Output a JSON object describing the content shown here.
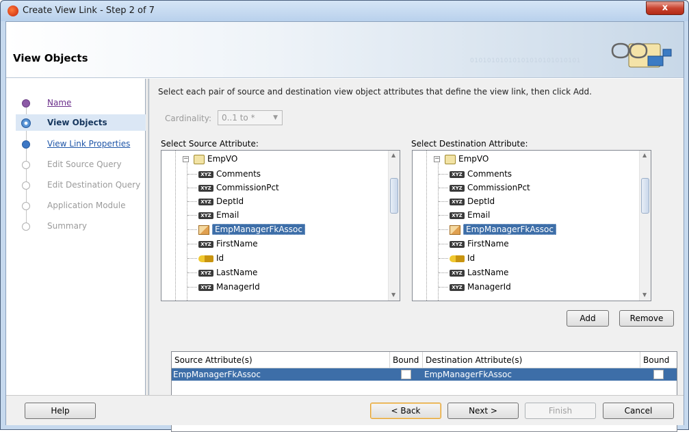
{
  "window": {
    "title": "Create View Link - Step 2 of 7",
    "close_glyph": "x"
  },
  "header": {
    "title": "View Objects",
    "binary_text": "01010101010101010101010101"
  },
  "nav": {
    "items": [
      {
        "label": "Name",
        "state": "done"
      },
      {
        "label": "View Objects",
        "state": "current"
      },
      {
        "label": "View Link Properties",
        "state": "next"
      },
      {
        "label": "Edit Source Query",
        "state": "disabled"
      },
      {
        "label": "Edit Destination Query",
        "state": "disabled"
      },
      {
        "label": "Application Module",
        "state": "disabled"
      },
      {
        "label": "Summary",
        "state": "disabled"
      }
    ]
  },
  "main": {
    "instructions": "Select each pair of source and destination view object attributes that define the view link, then click Add.",
    "cardinality_label": "Cardinality:",
    "cardinality_value": "0..1 to *",
    "source_label": "Select Source Attribute:",
    "destination_label": "Select Destination Attribute:"
  },
  "tree": {
    "root": "EmpVO",
    "attributes": [
      {
        "name": "Comments",
        "icon": "xyz-attribute-icon"
      },
      {
        "name": "CommissionPct",
        "icon": "xyz-attribute-icon"
      },
      {
        "name": "DeptId",
        "icon": "xyz-attribute-icon"
      },
      {
        "name": "Email",
        "icon": "xyz-attribute-icon"
      },
      {
        "name": "EmpManagerFkAssoc",
        "icon": "association-icon",
        "selected": true
      },
      {
        "name": "FirstName",
        "icon": "xyz-attribute-icon"
      },
      {
        "name": "Id",
        "icon": "key-icon"
      },
      {
        "name": "LastName",
        "icon": "xyz-attribute-icon"
      },
      {
        "name": "ManagerId",
        "icon": "xyz-attribute-icon"
      }
    ]
  },
  "buttons": {
    "add": "Add",
    "remove": "Remove",
    "help": "Help",
    "back": "< Back",
    "next": "Next >",
    "finish": "Finish",
    "cancel": "Cancel"
  },
  "pairs_table": {
    "headers": {
      "source": "Source Attribute(s)",
      "bound1": "Bound",
      "destination": "Destination Attribute(s)",
      "bound2": "Bound"
    },
    "rows": [
      {
        "source": "EmpManagerFkAssoc",
        "source_bound": false,
        "destination": "EmpManagerFkAssoc",
        "destination_bound": false
      }
    ]
  }
}
